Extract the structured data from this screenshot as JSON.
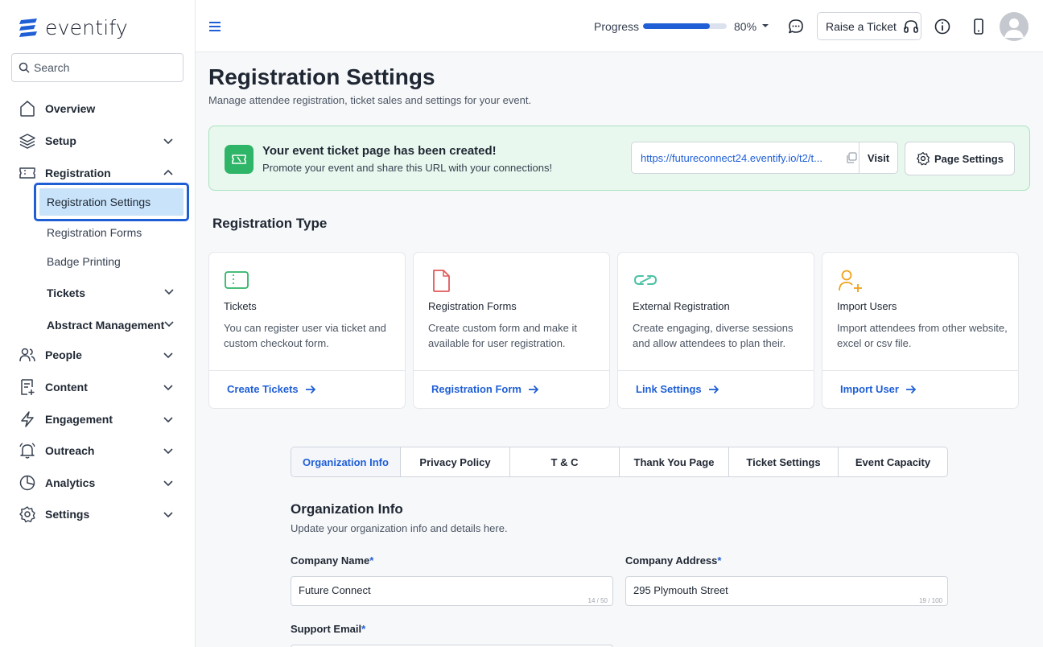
{
  "brand": {
    "name": "eventify",
    "accent": "#1f5fd6"
  },
  "search": {
    "placeholder": "Search"
  },
  "sidebar": {
    "items": [
      {
        "label": "Overview",
        "icon": "home-icon"
      },
      {
        "label": "Setup",
        "icon": "layers-icon"
      },
      {
        "label": "Registration",
        "icon": "ticket-icon"
      },
      {
        "label": "People",
        "icon": "people-icon"
      },
      {
        "label": "Content",
        "icon": "content-icon"
      },
      {
        "label": "Engagement",
        "icon": "bolt-icon"
      },
      {
        "label": "Outreach",
        "icon": "bell-icon"
      },
      {
        "label": "Analytics",
        "icon": "pie-chart-icon"
      },
      {
        "label": "Settings",
        "icon": "gear-icon"
      }
    ],
    "registration_sub": [
      {
        "label": "Registration Settings",
        "active": true
      },
      {
        "label": "Registration Forms"
      },
      {
        "label": "Badge Printing"
      },
      {
        "label": "Tickets"
      },
      {
        "label": "Abstract Management"
      }
    ]
  },
  "topbar": {
    "progress_label": "Progress",
    "progress_value": 80,
    "progress_text": "80%",
    "raise_ticket_label": "Raise a Ticket"
  },
  "page": {
    "title": "Registration Settings",
    "subtitle": "Manage attendee registration, ticket sales and settings for your event."
  },
  "banner": {
    "title": "Your event ticket page has been created!",
    "subtitle": "Promote your event and share this URL with your connections!",
    "url": "https://futureconnect24.eventify.io/t2/t...",
    "visit_label": "Visit",
    "page_settings_label": "Page Settings"
  },
  "registration_type": {
    "title": "Registration Type",
    "cards": [
      {
        "title": "Tickets",
        "desc": "You can register user via ticket and custom checkout form.",
        "link": "Create Tickets",
        "icon": "ticket-icon"
      },
      {
        "title": "Registration Forms",
        "desc": "Create custom form and make it available for user registration.",
        "link": "Registration Form",
        "icon": "document-icon"
      },
      {
        "title": "External Registration",
        "desc": "Create engaging, diverse sessions and allow attendees to plan their.",
        "link": "Link Settings",
        "icon": "link-icon"
      },
      {
        "title": "Import Users",
        "desc": "Import attendees from other website, excel or csv file.",
        "link": "Import User",
        "icon": "user-plus-icon"
      }
    ]
  },
  "tabs": [
    "Organization Info",
    "Privacy Policy",
    "T & C",
    "Thank You Page",
    "Ticket Settings",
    "Event Capacity"
  ],
  "org_form": {
    "title": "Organization Info",
    "subtitle": "Update your organization info and details here.",
    "company_name": {
      "label": "Company Name",
      "value": "Future Connect",
      "count": "14 / 50"
    },
    "company_address": {
      "label": "Company Address",
      "value": "295 Plymouth Street",
      "count": "19 / 100"
    },
    "support_email": {
      "label": "Support Email"
    },
    "required_mark": "*"
  }
}
